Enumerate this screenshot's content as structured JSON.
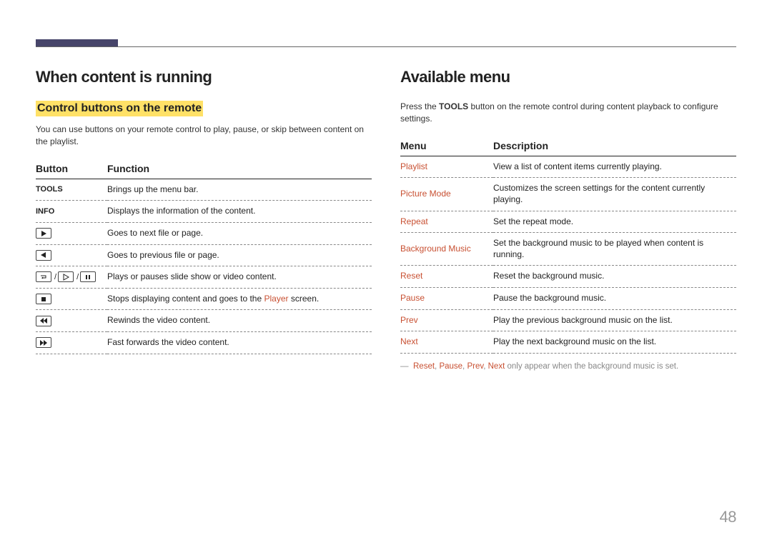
{
  "left": {
    "heading": "When content is running",
    "subheading": "Control buttons on the remote",
    "intro": "You can use buttons on your remote control to play, pause, or skip between content on the playlist.",
    "thead": {
      "c1": "Button",
      "c2": "Function"
    },
    "rows": [
      {
        "btn_text": "TOOLS",
        "btn_icon": null,
        "func_before": "Brings up the menu bar.",
        "func_red": "",
        "func_after": ""
      },
      {
        "btn_text": "INFO",
        "btn_icon": null,
        "func_before": "Displays the information of the content.",
        "func_red": "",
        "func_after": ""
      },
      {
        "btn_text": "",
        "btn_icon": "play-solid",
        "func_before": "Goes to next file or page.",
        "func_red": "",
        "func_after": ""
      },
      {
        "btn_text": "",
        "btn_icon": "rev-solid",
        "func_before": "Goes to previous file or page.",
        "func_red": "",
        "func_after": ""
      },
      {
        "btn_text": "",
        "btn_icon": "enter-play-pause",
        "func_before": "Plays or pauses slide show or video content.",
        "func_red": "",
        "func_after": ""
      },
      {
        "btn_text": "",
        "btn_icon": "stop",
        "func_before": "Stops displaying content and goes to the ",
        "func_red": "Player",
        "func_after": " screen."
      },
      {
        "btn_text": "",
        "btn_icon": "rewind",
        "func_before": "Rewinds the video content.",
        "func_red": "",
        "func_after": ""
      },
      {
        "btn_text": "",
        "btn_icon": "ffwd",
        "func_before": "Fast forwards the video content.",
        "func_red": "",
        "func_after": ""
      }
    ]
  },
  "right": {
    "heading": "Available menu",
    "intro_before": "Press the ",
    "intro_bold": "TOOLS",
    "intro_after": " button on the remote control during content playback to configure settings.",
    "thead": {
      "c1": "Menu",
      "c2": "Description"
    },
    "rows": [
      {
        "name": "Playlist",
        "desc": "View a list of content items currently playing."
      },
      {
        "name": "Picture Mode",
        "desc": "Customizes the screen settings for the content currently playing."
      },
      {
        "name": "Repeat",
        "desc": "Set the repeat mode."
      },
      {
        "name": "Background Music",
        "desc": "Set the background music to be played when content is running."
      },
      {
        "name": "Reset",
        "desc": "Reset the background music."
      },
      {
        "name": "Pause",
        "desc": "Pause the background music."
      },
      {
        "name": "Prev",
        "desc": "Play the previous background music on the list."
      },
      {
        "name": "Next",
        "desc": "Play the next background music on the list."
      }
    ],
    "note": {
      "dash": "―",
      "w1": "Reset",
      "s1": ", ",
      "w2": "Pause",
      "s2": ", ",
      "w3": "Prev",
      "s3": ", ",
      "w4": "Next",
      "rest": " only appear when the background music is set."
    }
  },
  "page_no": "48"
}
